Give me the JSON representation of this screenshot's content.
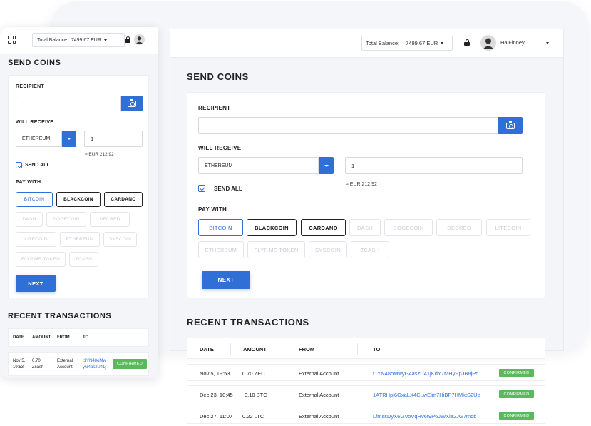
{
  "desktop": {
    "topbar": {
      "balance_label": "Total Balance:",
      "balance_value": "7499.67 EUR",
      "username": "HalFinney"
    },
    "send": {
      "title": "SEND COINS",
      "recipient_label": "RECIPIENT",
      "recipient_value": "",
      "will_receive_label": "WILL RECEIVE",
      "currency": "ETHEREUM",
      "amount": "1",
      "eur_equiv": "≈ EUR 212.92",
      "send_all_label": "SEND ALL",
      "send_all_checked": true,
      "pay_with_label": "PAY WITH",
      "coins": [
        {
          "label": "BITCOIN",
          "state": "selected"
        },
        {
          "label": "BLACKCOIN",
          "state": "available"
        },
        {
          "label": "CARDANO",
          "state": "available"
        },
        {
          "label": "DASH",
          "state": "disabled"
        },
        {
          "label": "DOGECOIN",
          "state": "disabled"
        },
        {
          "label": "DECRED",
          "state": "disabled"
        },
        {
          "label": "LITECOIN",
          "state": "disabled"
        },
        {
          "label": "ETHEREUM",
          "state": "disabled"
        },
        {
          "label": "FLYP.ME TOKEN",
          "state": "disabled"
        },
        {
          "label": "SYSCOIN",
          "state": "disabled"
        },
        {
          "label": "ZCASH",
          "state": "disabled"
        }
      ],
      "next_label": "NEXT"
    },
    "recent": {
      "title": "RECENT TRANSACTIONS",
      "columns": [
        "DATE",
        "AMOUNT",
        "FROM",
        "TO"
      ],
      "rows": [
        {
          "date": "Nov 5, 19:53",
          "amount": "0.70 ZEC",
          "from": "External Account",
          "to": "t1YN48oMwyG4aszU41jKdY7MHyPpJB8jPq",
          "status": "CONFIRMED"
        },
        {
          "date": "Dec 23, 10:45",
          "amount": "0.10 BTC",
          "from": "External Account",
          "to": "1ATRHpi6GxaLX4CLwEim7HiBP7HMktS2Uc",
          "status": "CONFIRMED"
        },
        {
          "date": "Dec 27, 11:07",
          "amount": "0.22 LTC",
          "from": "External Account",
          "to": "LfmssDyX6iZVoVqHv6t9P6JWXia2JG7mdb",
          "status": "CONFIRMED"
        }
      ]
    }
  },
  "mobile": {
    "topbar": {
      "balance_label": "Total Balance :",
      "balance_value": "7499.67 EUR"
    },
    "send": {
      "title": "SEND COINS",
      "recipient_label": "RECIPIENT",
      "will_receive_label": "WILL RECEIVE",
      "currency": "ETHEREUM",
      "amount": "1",
      "eur_equiv": "≈ EUR 212.92",
      "send_all_label": "SEND ALL",
      "pay_with_label": "PAY WITH",
      "next_label": "NEXT"
    },
    "recent": {
      "title": "RECENT TRANSACTIONS",
      "columns": [
        "DATE",
        "AMOUNT",
        "FROM",
        "TO"
      ],
      "row": {
        "date_line1": "Nov 5,",
        "date_line2": "19:53",
        "amount_line1": "0.70",
        "amount_line2": "Zcash",
        "from_line1": "External",
        "from_line2": "Account",
        "to_line1": "t1YN48oMw",
        "to_line2": "yG4aszU41j",
        "status": "CONFIRMED"
      }
    }
  },
  "colors": {
    "accent": "#2f6fd6",
    "confirmed": "#5cb85c",
    "background": "#f4f5f8"
  },
  "icons": [
    "grid-icon",
    "lock-icon",
    "avatar-icon",
    "camera-icon",
    "chevron-down-icon",
    "checkbox-icon"
  ]
}
